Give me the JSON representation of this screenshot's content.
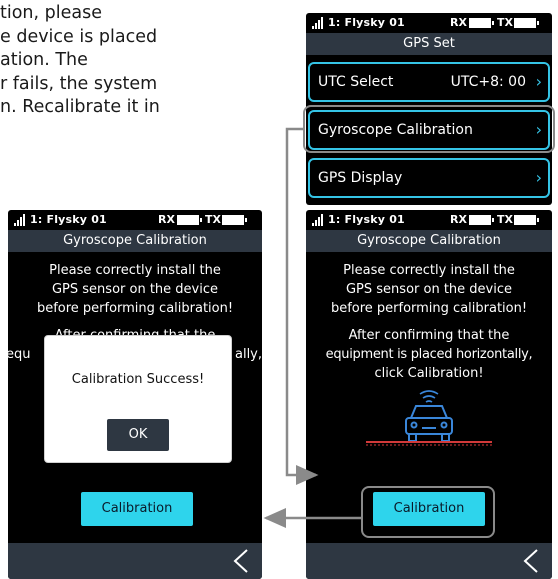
{
  "document": {
    "lines": [
      "tion, please",
      "e device is placed",
      "ation. The",
      "r fails, the system",
      "n. Recalibrate it in"
    ]
  },
  "statusbar": {
    "model": "1: Flysky  01",
    "rx": "RX",
    "tx": "TX"
  },
  "gps_screen": {
    "title": "GPS Set",
    "items": [
      {
        "label": "UTC Select",
        "value": "UTC+8: 00"
      },
      {
        "label": "Gyroscope Calibration",
        "value": ""
      },
      {
        "label": "GPS Display",
        "value": ""
      }
    ]
  },
  "calib_screen": {
    "title": "Gyroscope Calibration",
    "message_1": [
      "Please correctly install the",
      "GPS sensor on the device",
      "before performing calibration!"
    ],
    "message_2": [
      "After confirming that the",
      "equipment is placed horizontally,",
      "click Calibration!"
    ],
    "button": "Calibration"
  },
  "success_screen": {
    "title": "Gyroscope Calibration",
    "message_1": [
      "Please correctly install the",
      "GPS sensor on the device",
      "before performing calibration!"
    ],
    "message_2_partial": [
      "After confirming that the",
      "equ",
      "ally,"
    ],
    "dialog_message": "Calibration Success!",
    "dialog_ok": "OK",
    "button": "Calibration"
  },
  "colors": {
    "accent": "#2ed4ec",
    "bar": "#2e3742",
    "screen_bg": "#000000",
    "highlight": "#8a8a8a",
    "ground_line": "#d23a3a",
    "car": "#3a86d9"
  },
  "icons": [
    "signal-icon",
    "battery-icon",
    "chevron-right-icon",
    "back-chevron-icon",
    "car-icon",
    "wifi-signal-icon"
  ]
}
